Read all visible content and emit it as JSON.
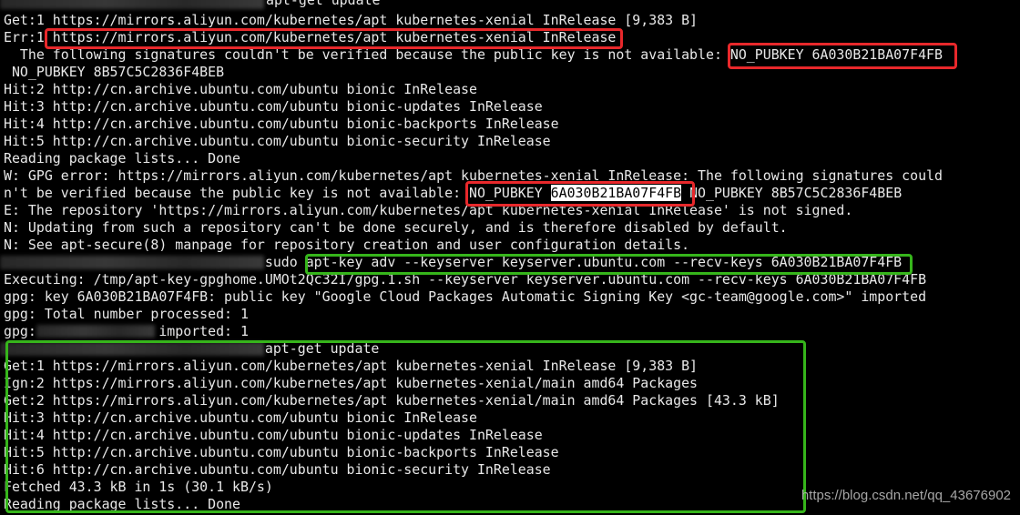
{
  "terminal": {
    "lines": [
      "Get:1 https://mirrors.aliyun.com/kubernetes/apt kubernetes-xenial InRelease [9,383 B]",
      "Err:1 https://mirrors.aliyun.com/kubernetes/apt kubernetes-xenial InRelease",
      "  The following signatures couldn't be verified because the public key is not available: NO_PUBKEY 6A030B21BA07F4FB",
      " NO_PUBKEY 8B57C5C2836F4BEB",
      "Hit:2 http://cn.archive.ubuntu.com/ubuntu bionic InRelease",
      "Hit:3 http://cn.archive.ubuntu.com/ubuntu bionic-updates InRelease",
      "Hit:4 http://cn.archive.ubuntu.com/ubuntu bionic-backports InRelease",
      "Hit:5 http://cn.archive.ubuntu.com/ubuntu bionic-security InRelease",
      "Reading package lists... Done",
      "W: GPG error: https://mirrors.aliyun.com/kubernetes/apt kubernetes-xenial InRelease: The following signatures could",
      "n't be verified because the public key is not available: NO_PUBKEY 6A030B21BA07F4FB NO_PUBKEY 8B57C5C2836F4BEB",
      "E: The repository 'https://mirrors.aliyun.com/kubernetes/apt kubernetes-xenial InRelease' is not signed.",
      "N: Updating from such a repository can't be done securely, and is therefore disabled by default.",
      "N: See apt-secure(8) manpage for repository creation and user configuration details.",
      "                                sudo apt-key adv --keyserver keyserver.ubuntu.com --recv-keys 6A030B21BA07F4FB",
      "Executing: /tmp/apt-key-gpghome.UMOt2Qc32I/gpg.1.sh --keyserver keyserver.ubuntu.com --recv-keys 6A030B21BA07F4FB",
      "gpg: key 6A030B21BA07F4FB: public key \"Google Cloud Packages Automatic Signing Key <gc-team@google.com>\" imported",
      "gpg: Total number processed: 1",
      "gpg:               imported: 1",
      "                                apt-get update",
      "Get:1 https://mirrors.aliyun.com/kubernetes/apt kubernetes-xenial InRelease [9,383 B]",
      "Ign:2 https://mirrors.aliyun.com/kubernetes/apt kubernetes-xenial/main amd64 Packages",
      "Get:2 https://mirrors.aliyun.com/kubernetes/apt kubernetes-xenial/main amd64 Packages [43.3 kB]",
      "Hit:3 http://cn.archive.ubuntu.com/ubuntu bionic InRelease",
      "Hit:4 http://cn.archive.ubuntu.com/ubuntu bionic-updates InRelease",
      "Hit:5 http://cn.archive.ubuntu.com/ubuntu bionic-backports InRelease",
      "Hit:6 http://cn.archive.ubuntu.com/ubuntu bionic-security InRelease",
      "Fetched 43.3 kB in 1s (30.1 kB/s)",
      "Reading package lists... Done"
    ],
    "top_command": "apt-get update",
    "highlight": {
      "prefix": "n't be verified because the public key is not available: NO_PUBKEY ",
      "selected": "6A030B21BA07F4FB",
      "suffix": " NO_PUBKEY 8B57C5C2836F4BEB"
    }
  },
  "watermark": "https://blog.csdn.net/qq_43676902",
  "colors": {
    "background": "#000000",
    "text": "#e8e8e8",
    "annotation_red": "#e8282b",
    "annotation_green": "#36b51b"
  }
}
